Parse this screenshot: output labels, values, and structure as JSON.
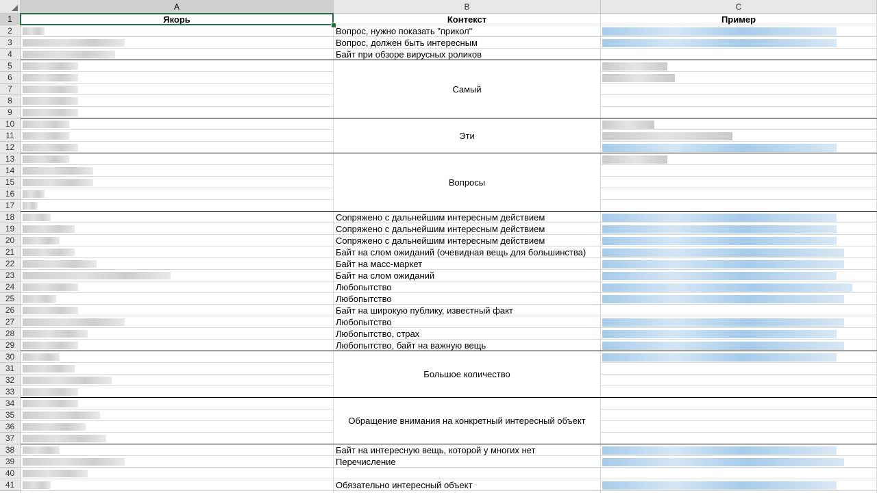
{
  "spreadsheet": {
    "columns": [
      {
        "letter": "A",
        "header": "Якорь"
      },
      {
        "letter": "B",
        "header": "Контекст"
      },
      {
        "letter": "C",
        "header": "Пример"
      }
    ],
    "row_numbers": [
      "1",
      "2",
      "3",
      "4",
      "5",
      "6",
      "7",
      "8",
      "9",
      "10",
      "11",
      "12",
      "13",
      "14",
      "15",
      "16",
      "17",
      "18",
      "19",
      "20",
      "21",
      "22",
      "23",
      "24",
      "25",
      "26",
      "27",
      "28",
      "29",
      "30",
      "31",
      "32",
      "33",
      "34",
      "35",
      "36",
      "37",
      "38",
      "39",
      "40",
      "41"
    ],
    "context_cells": [
      {
        "row": 2,
        "text": "Вопрос, нужно показать \"прикол\""
      },
      {
        "row": 3,
        "text": "Вопрос, должен быть интересным"
      },
      {
        "row": 4,
        "text": "Байт при обзоре вирусных роликов"
      },
      {
        "row": 18,
        "text": "Сопряжено с дальнейшим интересным действием"
      },
      {
        "row": 19,
        "text": "Сопряжено с дальнейшим интересным действием"
      },
      {
        "row": 20,
        "text": "Сопряжено с дальнейшим интересным действием"
      },
      {
        "row": 21,
        "text": "Байт на слом ожиданий (очевидная вещь для большинства)"
      },
      {
        "row": 22,
        "text": "Байт на масс-маркет"
      },
      {
        "row": 23,
        "text": "Байт на слом ожиданий"
      },
      {
        "row": 24,
        "text": "Любопытство"
      },
      {
        "row": 25,
        "text": "Любопытство"
      },
      {
        "row": 26,
        "text": "Байт на широкую публику, известный факт"
      },
      {
        "row": 27,
        "text": "Любопытство"
      },
      {
        "row": 28,
        "text": "Любопытство, страх"
      },
      {
        "row": 29,
        "text": "Любопытство, байт на важную вещь"
      },
      {
        "row": 38,
        "text": "Байт на интересную вещь, которой у многих нет"
      },
      {
        "row": 39,
        "text": "Перечисление"
      },
      {
        "row": 41,
        "text": "Обязательно интересный объект"
      }
    ],
    "merged_context": [
      {
        "first": 5,
        "last": 9,
        "text": "Самый"
      },
      {
        "first": 10,
        "last": 12,
        "text": "Эти"
      },
      {
        "first": 13,
        "last": 17,
        "text": "Вопросы"
      },
      {
        "first": 30,
        "last": 33,
        "text": "Большое количество"
      },
      {
        "first": 34,
        "last": 37,
        "text": "Обращение внимания на конкретный интересный объект"
      }
    ],
    "group_boundaries_after_rows": [
      4,
      9,
      12,
      17,
      29,
      33,
      37
    ],
    "anchor_blur_lengths": [
      0.3,
      0.12,
      0.55,
      0.5,
      0.3,
      0.3,
      0.3,
      0.3,
      0.3,
      0.25,
      0.25,
      0.3,
      0.25,
      0.38,
      0.38,
      0.12,
      0.08,
      0.15,
      0.28,
      0.2,
      0.28,
      0.4,
      0.8,
      0.3,
      0.18,
      0.3,
      0.55,
      0.35,
      0.3,
      0.2,
      0.28,
      0.48,
      0.3,
      0.3,
      0.42,
      0.34,
      0.45,
      0.2,
      0.55,
      0.35,
      0.15
    ],
    "example_blur_rows": [
      {
        "row": 2,
        "kind": "blue",
        "len": 0.9
      },
      {
        "row": 3,
        "kind": "blue",
        "len": 0.9
      },
      {
        "row": 5,
        "kind": "gray",
        "len": 0.25
      },
      {
        "row": 6,
        "kind": "gray",
        "len": 0.28
      },
      {
        "row": 10,
        "kind": "gray",
        "len": 0.2
      },
      {
        "row": 11,
        "kind": "gray",
        "len": 0.5
      },
      {
        "row": 12,
        "kind": "blue",
        "len": 0.9
      },
      {
        "row": 13,
        "kind": "gray",
        "len": 0.25
      },
      {
        "row": 18,
        "kind": "blue",
        "len": 0.9
      },
      {
        "row": 19,
        "kind": "blue",
        "len": 0.9
      },
      {
        "row": 20,
        "kind": "blue",
        "len": 0.9
      },
      {
        "row": 21,
        "kind": "blue",
        "len": 0.93
      },
      {
        "row": 22,
        "kind": "blue",
        "len": 0.93
      },
      {
        "row": 23,
        "kind": "blue",
        "len": 0.9
      },
      {
        "row": 24,
        "kind": "blue",
        "len": 0.96
      },
      {
        "row": 25,
        "kind": "blue",
        "len": 0.93
      },
      {
        "row": 27,
        "kind": "blue",
        "len": 0.93
      },
      {
        "row": 28,
        "kind": "blue",
        "len": 0.9
      },
      {
        "row": 29,
        "kind": "blue",
        "len": 0.93
      },
      {
        "row": 30,
        "kind": "blue",
        "len": 0.9
      },
      {
        "row": 38,
        "kind": "blue",
        "len": 0.9
      },
      {
        "row": 39,
        "kind": "blue",
        "len": 0.93
      },
      {
        "row": 41,
        "kind": "blue",
        "len": 0.9
      }
    ],
    "selected_cell": "A1",
    "colors": {
      "selection": "#217346",
      "header_bg": "#e8e8e8",
      "header_selected_bg": "#d0d0d0",
      "gridline": "#d9d9d9",
      "blur_gray": "#bdbdbd",
      "blur_blue": "#8fbfe6"
    }
  }
}
